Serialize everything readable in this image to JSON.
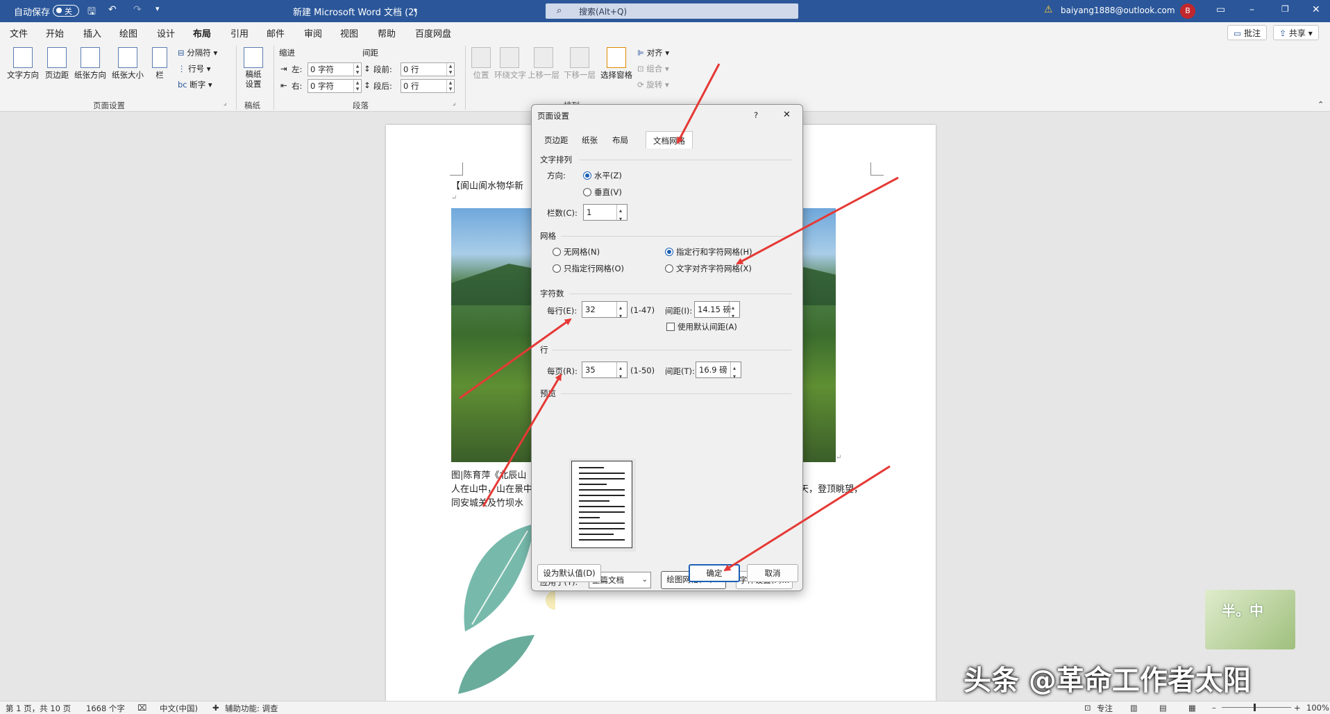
{
  "titlebar": {
    "autosave_label": "自动保存",
    "autosave_state": "关",
    "doc_title": "新建 Microsoft Word 文档 (2)",
    "search_placeholder": "搜索(Alt+Q)",
    "account_email": "baiyang1888@outlook.com",
    "avatar_initial": "B"
  },
  "ribbon_tabs": [
    "文件",
    "开始",
    "插入",
    "绘图",
    "设计",
    "布局",
    "引用",
    "邮件",
    "审阅",
    "视图",
    "帮助",
    "百度网盘"
  ],
  "active_tab": "布局",
  "top_right": {
    "comments": "批注",
    "share": "共享"
  },
  "ribbon": {
    "page_setup": {
      "buttons": [
        "文字方向",
        "页边距",
        "纸张方向",
        "纸张大小",
        "栏"
      ],
      "small": [
        "分隔符",
        "行号",
        "断字"
      ],
      "group_label": "页面设置"
    },
    "draft": {
      "button": "稿纸设置",
      "group_label": "稿纸"
    },
    "paragraph": {
      "indent_label": "缩进",
      "spacing_label": "间距",
      "left_label": "左:",
      "right_label": "右:",
      "before_label": "段前:",
      "after_label": "段后:",
      "left_value": "0 字符",
      "right_value": "0 字符",
      "before_value": "0 行",
      "after_value": "0 行",
      "group_label": "段落"
    },
    "arrange": {
      "buttons": [
        "位置",
        "环绕文字",
        "上移一层",
        "下移一层",
        "选择窗格"
      ],
      "small": [
        "对齐",
        "组合",
        "旋转"
      ],
      "group_label": "排列"
    }
  },
  "document": {
    "heading_line": "【阆山阆水物华新",
    "caption_line1": "图|陈育萍《北辰山",
    "caption_line2": "人在山中，山在景中",
    "caption_line2_right": "天，登顶眺望，",
    "caption_line3": "同安城关及竹坝水"
  },
  "dialog": {
    "title": "页面设置",
    "help": "?",
    "close": "✕",
    "tabs": [
      "页边距",
      "纸张",
      "布局",
      "文档网格"
    ],
    "active_tab": "文档网格",
    "text_direction_section": "文字排列",
    "direction_label": "方向:",
    "horizontal": "水平(Z)",
    "vertical": "垂直(V)",
    "columns_label": "栏数(C):",
    "columns_value": "1",
    "grid_section": "网格",
    "grid_none": "无网格(N)",
    "grid_lines_only": "只指定行网格(O)",
    "grid_lines_chars": "指定行和字符网格(H)",
    "grid_snap": "文字对齐字符网格(X)",
    "grid_selected": "指定行和字符网格(H)",
    "chars_section": "字符数",
    "per_line_label": "每行(E):",
    "per_line_value": "32",
    "per_line_range": "(1-47)",
    "char_pitch_label": "间距(I):",
    "char_pitch_value": "14.15 磅",
    "default_pitch": "使用默认间距(A)",
    "lines_section": "行",
    "per_page_label": "每页(R):",
    "per_page_value": "35",
    "per_page_range": "(1-50)",
    "line_pitch_label": "间距(T):",
    "line_pitch_value": "16.9 磅",
    "preview_section": "预览",
    "apply_to_label": "应用于(Y):",
    "apply_to_value": "整篇文档",
    "drawing_grid_button": "绘图网格(W)...",
    "font_settings_button": "字体设置(F)...",
    "set_default_button": "设为默认值(D)",
    "ok_button": "确定",
    "cancel_button": "取消"
  },
  "statusbar": {
    "page": "第 1 页，共 10 页",
    "words": "1668 个字",
    "language": "中文(中国)",
    "accessibility": "辅助功能: 调查",
    "focus": "专注",
    "zoom": "100%"
  },
  "watermark": {
    "text": "头条 @革命工作者太阳",
    "logo_text": "半。中"
  },
  "colors": {
    "titlebar": "#2b579a",
    "ribbon": "#f3f3f3",
    "accent": "#1a5fb4",
    "annotation_arrow": "#e53935"
  }
}
